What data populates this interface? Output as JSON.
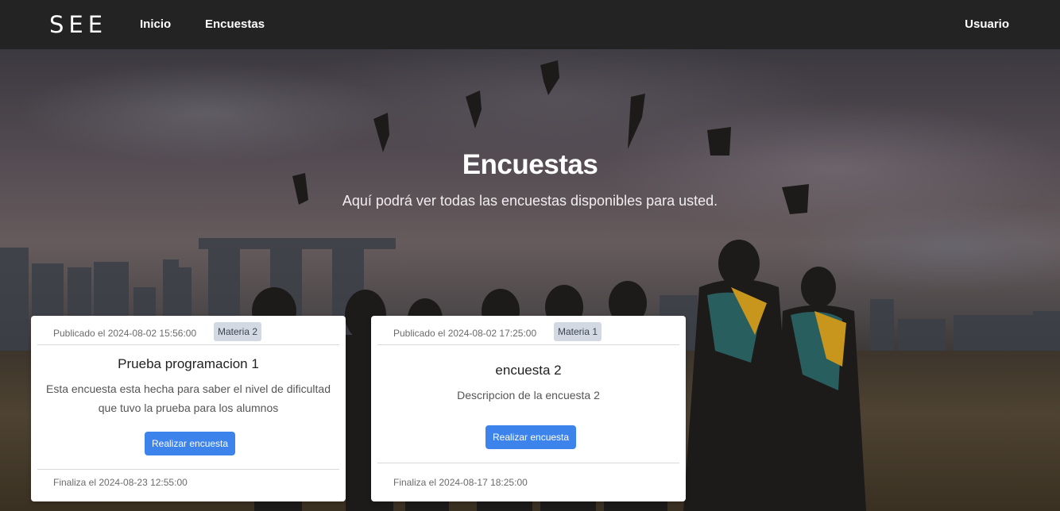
{
  "navbar": {
    "brand": "SEE",
    "links": [
      "Inicio",
      "Encuestas"
    ],
    "user": "Usuario",
    "bg_color": "#232323"
  },
  "hero": {
    "title": "Encuestas",
    "subtitle": "Aquí podrá ver todas las encuestas disponibles para usted."
  },
  "surveys": [
    {
      "published": "Publicado el 2024-08-02 15:56:00",
      "badge": "Materia 2",
      "title": "Prueba programacion 1",
      "description_lines": [
        "Esta encuesta esta hecha para saber el nivel de dificultad",
        "que tuvo la prueba para los alumnos"
      ],
      "button": "Realizar encuesta",
      "ends": "Finaliza el 2024-08-23 12:55:00"
    },
    {
      "published": "Publicado el 2024-08-02 17:25:00",
      "badge": "Materia 1",
      "title": "encuesta 2",
      "description_lines": [
        "Descripcion de la encuesta 2"
      ],
      "button": "Realizar encuesta",
      "ends": "Finaliza el 2024-08-17 18:25:00"
    }
  ],
  "colors": {
    "button": "#3d83ec",
    "badge": "#d2d9e2"
  }
}
